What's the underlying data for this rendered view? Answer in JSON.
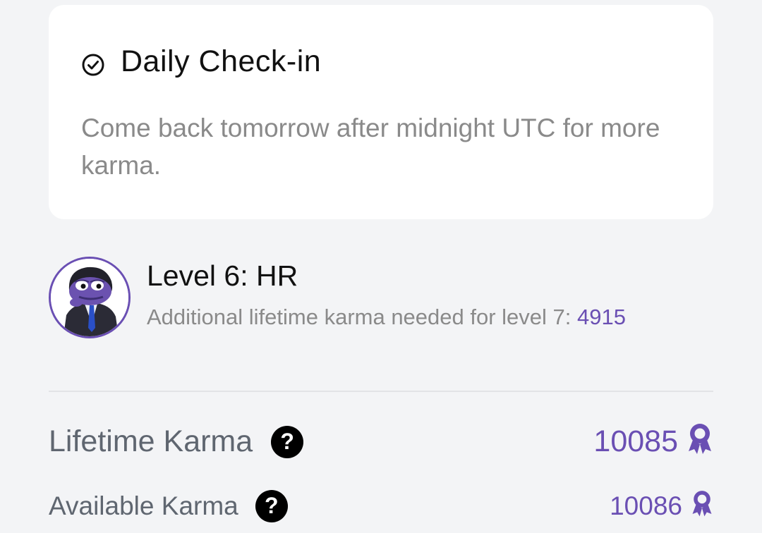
{
  "checkin": {
    "title": "Daily Check-in",
    "description": "Come back tomorrow after midnight UTC for more karma.",
    "icon": "check-circle-icon"
  },
  "level": {
    "title": "Level 6: HR",
    "subtitle": "Additional lifetime karma needed for level 7: ",
    "needed": "4915",
    "avatar": "pepe-avatar"
  },
  "karma": {
    "lifetime_label": "Lifetime Karma",
    "lifetime_value": "10085",
    "available_label": "Available Karma",
    "available_value": "10086",
    "help_glyph": "?",
    "badge_icon": "award-ribbon-icon"
  },
  "colors": {
    "accent": "#6a4fb3",
    "background": "#f3f4f6",
    "card": "#ffffff",
    "muted_text": "#8a8a8a"
  }
}
